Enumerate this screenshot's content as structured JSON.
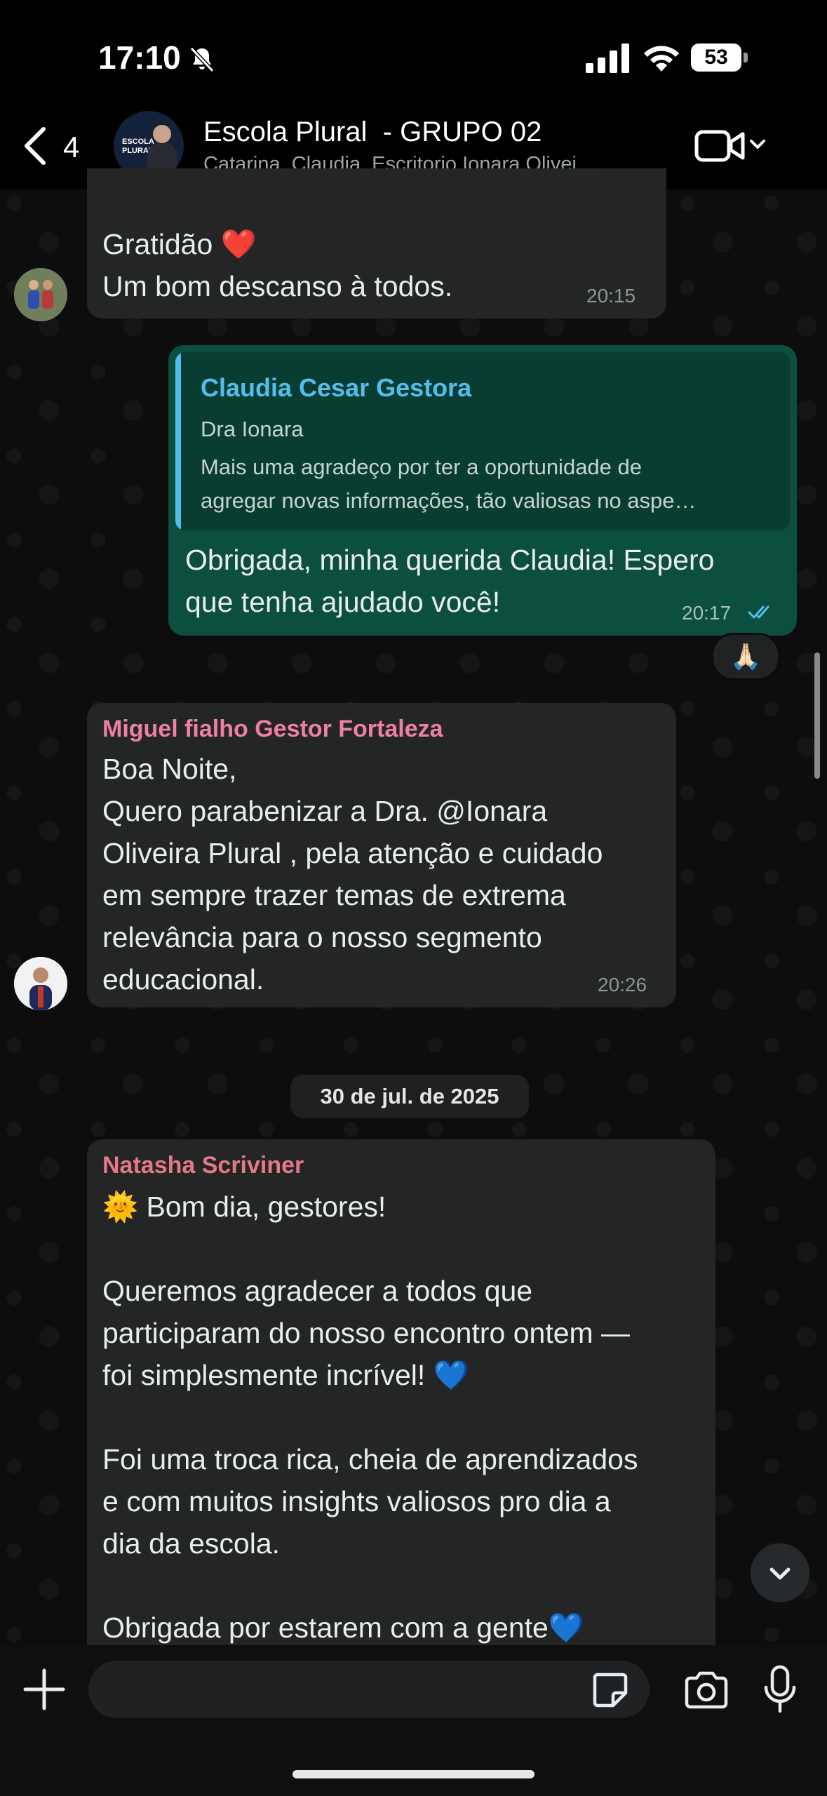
{
  "status_bar": {
    "time": "17:10",
    "battery": "53"
  },
  "header": {
    "back_count": "4",
    "title": "Escola Plural  - GRUPO 02",
    "members": "Catarina, Claudia, Escritorio Ionara Olivei…",
    "avatar_text": "ESCOLA\nPLURAL"
  },
  "messages": [
    {
      "type": "incoming",
      "text": "Gratidão ❤️\nUm bom descanso à todos.",
      "time": "20:15"
    },
    {
      "type": "outgoing",
      "quote": {
        "name": "Claudia Cesar Gestora",
        "subtitle": "Dra Ionara",
        "body": "Mais uma agradeço por ter a oportunidade de\nagregar novas informações, tão valiosas no aspe…"
      },
      "text": "Obrigada, minha querida Claudia! Espero\nque tenha ajudado você!",
      "time": "20:17",
      "read_icon": "double-check-icon",
      "reaction": "🙏🏻"
    },
    {
      "type": "incoming",
      "sender": "Miguel fialho Gestor Fortaleza",
      "sender_color": "#ee7fa6",
      "text": "Boa Noite,\nQuero parabenizar a Dra. @Ionara\nOliveira Plural , pela atenção e cuidado\nem sempre trazer temas de extrema\nrelevância para o nosso segmento\neducacional.",
      "time": "20:26"
    },
    {
      "type": "date",
      "label": "30 de jul. de 2025"
    },
    {
      "type": "incoming",
      "sender": "Natasha Scriviner",
      "sender_color": "#e5788a",
      "text": "🌞 Bom dia, gestores!\n\nQueremos agradecer a todos que\nparticiparam do nosso encontro ontem —\nfoi simplesmente incrível! 💙\n\nFoi uma troca rica, cheia de aprendizados\ne com muitos insights valiosos pro dia a\ndia da escola.\n\nObrigada por estarem com a gente💙"
    }
  ],
  "input": {
    "placeholder": ""
  },
  "colors": {
    "incoming_bubble": "#242626",
    "outgoing_bubble": "#0c4f3f",
    "quote_accent": "#53bdeb",
    "read_ticks": "#53bdeb"
  }
}
